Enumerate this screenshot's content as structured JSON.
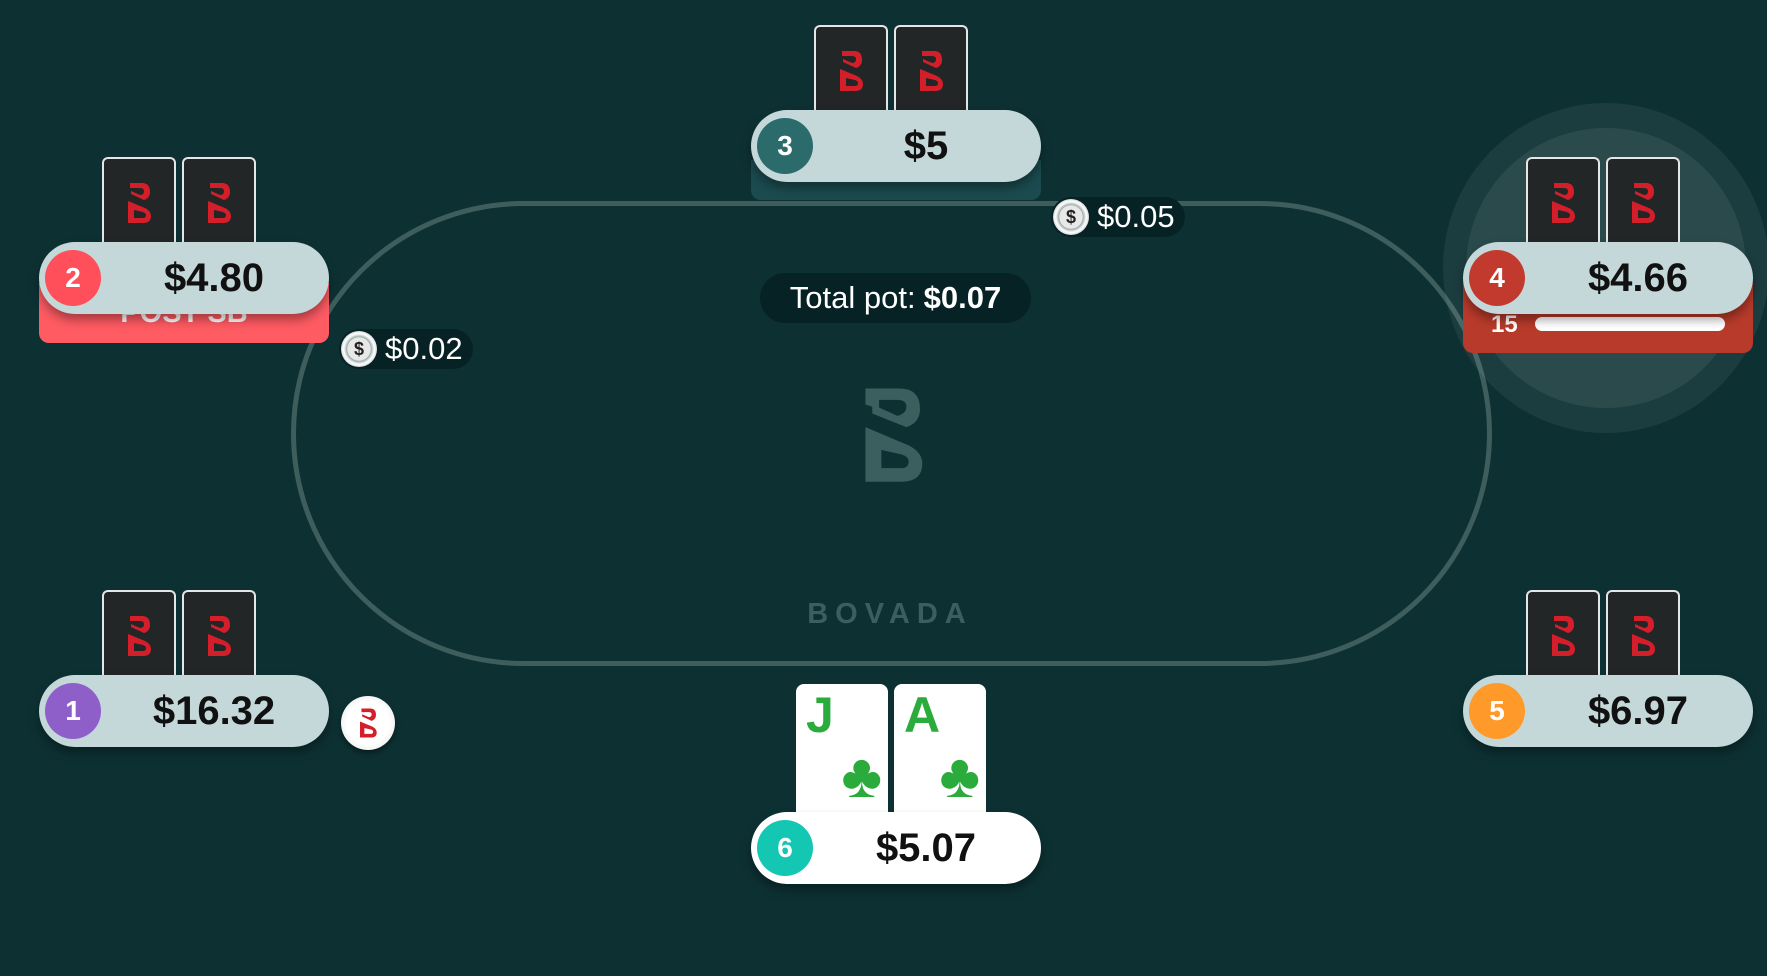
{
  "table": {
    "brand": "BOVADA",
    "total_pot_label": "Total pot:",
    "total_pot_value": "$0.07"
  },
  "seats": [
    {
      "num": "1",
      "stack": "$16.32",
      "color": "#8e5fc8"
    },
    {
      "num": "2",
      "stack": "$4.80",
      "color": "#ff4f5a",
      "action": "POST SB"
    },
    {
      "num": "3",
      "stack": "$5",
      "color": "#2c6b6c"
    },
    {
      "num": "4",
      "stack": "$4.66",
      "color": "#c23a2e",
      "timer": "15",
      "timer_fraction": 1.0
    },
    {
      "num": "5",
      "stack": "$6.97",
      "color": "#ff9a2a"
    },
    {
      "num": "6",
      "stack": "$5.07",
      "color": "#14c7b3"
    }
  ],
  "bets": {
    "seat2": "$0.02",
    "seat3": "$0.05"
  },
  "hero_cards": [
    {
      "rank": "J",
      "suit": "♣"
    },
    {
      "rank": "A",
      "suit": "♣"
    }
  ],
  "chip_symbol": "$",
  "icons": {
    "card_back": "bovada-b-logo",
    "dealer": "dealer-button-icon",
    "chip": "chip-icon"
  },
  "colors": {
    "felt": "#0d3133",
    "rail": "#3e5e5e",
    "card_logo_red": "#d41f2a",
    "suit_green": "#2bab3c"
  }
}
